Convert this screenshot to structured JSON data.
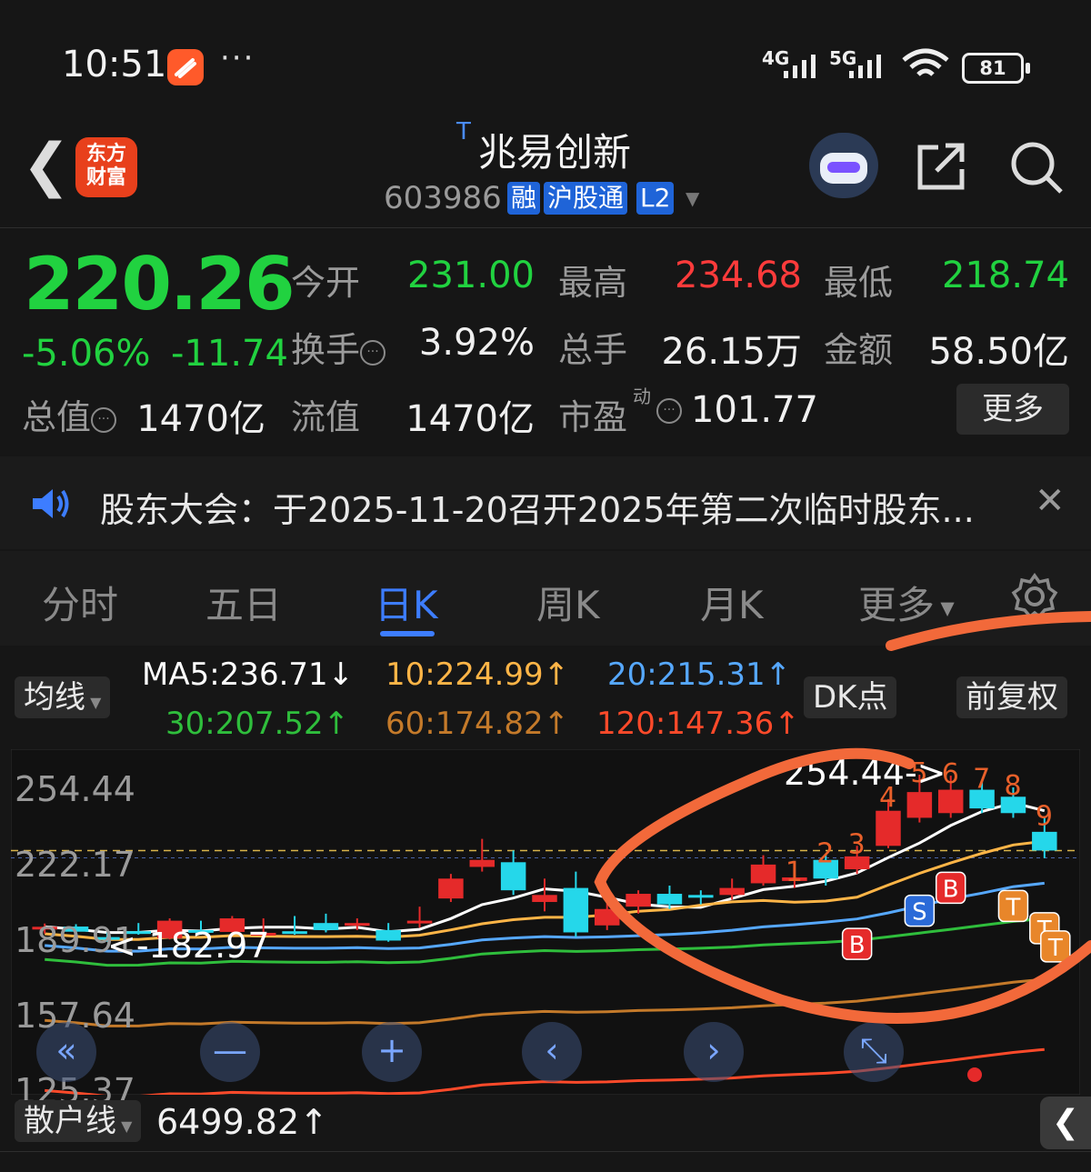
{
  "status_bar": {
    "time": "10:51",
    "more": "···",
    "net1": "4G",
    "net2": "5G",
    "battery": "81",
    "icons": [
      "signal-icon",
      "wifi-icon",
      "battery-icon"
    ]
  },
  "header": {
    "app_logo": "东方\n财富",
    "badge": "T",
    "stock_name": "兆易创新",
    "stock_code": "603986",
    "tags": [
      "融",
      "沪股通",
      "L2"
    ]
  },
  "quote": {
    "price": "220.26",
    "change_pct": "-5.06%",
    "change_abs": "-11.74",
    "open_label": "今开",
    "open": "231.00",
    "high_label": "最高",
    "high": "234.68",
    "low_label": "最低",
    "low": "218.74",
    "turnover_label": "换手",
    "turnover": "3.92%",
    "volume_label": "总手",
    "volume": "26.15万",
    "amount_label": "金额",
    "amount": "58.50亿",
    "mktcap_label": "总值",
    "mktcap": "1470亿",
    "float_label": "流值",
    "float": "1470亿",
    "pe_label": "市盈",
    "pe_sup": "动",
    "pe": "101.77",
    "more_button": "更多",
    "colors": {
      "down": "#21d240",
      "up": "#ff3b3b"
    }
  },
  "notice": {
    "text": "股东大会：于2025-11-20召开2025年第二次临时股东..."
  },
  "tabs": [
    "分时",
    "五日",
    "日K",
    "周K",
    "月K",
    "更多"
  ],
  "active_tab": "日K",
  "ma_row": {
    "selector": "均线",
    "ma5": "MA5:236.71↓",
    "ma10": "10:224.99↑",
    "ma20": "20:215.31↑",
    "ma30": "30:207.52↑",
    "ma60": "60:174.82↑",
    "ma120": "120:147.36↑",
    "dk": "DK点",
    "adjust": "前复权",
    "colors": {
      "ma5": "#ffffff",
      "ma10": "#ffb547",
      "ma20": "#56a8ff",
      "ma30": "#2fbe3c",
      "ma60": "#c47a2a",
      "ma120": "#ff4a2a"
    }
  },
  "chart_data": {
    "type": "candlestick",
    "y_ticks": [
      "254.44",
      "222.17",
      "189.91",
      "157.64",
      "125.37"
    ],
    "ylim": [
      125.37,
      254.44
    ],
    "annotations": {
      "high": "254.44->",
      "low": "<-182.97"
    },
    "markers_red_numbers": [
      "1",
      "2",
      "3",
      "4",
      "5",
      "6",
      "7",
      "8",
      "9"
    ],
    "signals": [
      "B",
      "S",
      "B",
      "T",
      "T",
      "T"
    ],
    "candles": [
      {
        "o": 188.5,
        "c": 189.4,
        "h": 190.8,
        "l": 186.5
      },
      {
        "o": 189.5,
        "c": 187.3,
        "h": 190.5,
        "l": 185.5
      },
      {
        "o": 185.0,
        "c": 184.2,
        "h": 187.0,
        "l": 182.97
      },
      {
        "o": 187.5,
        "c": 187.0,
        "h": 191.0,
        "l": 186.0
      },
      {
        "o": 184.5,
        "c": 192.0,
        "h": 193.0,
        "l": 184.0
      },
      {
        "o": 188.0,
        "c": 187.4,
        "h": 192.0,
        "l": 186.0
      },
      {
        "o": 187.2,
        "c": 193.0,
        "h": 194.0,
        "l": 187.0
      },
      {
        "o": 186.0,
        "c": 186.8,
        "h": 193.0,
        "l": 185.0
      },
      {
        "o": 187.5,
        "c": 187.0,
        "h": 194.0,
        "l": 186.0
      },
      {
        "o": 191.0,
        "c": 188.0,
        "h": 195.0,
        "l": 187.0
      },
      {
        "o": 190.0,
        "c": 191.0,
        "h": 193.0,
        "l": 188.0
      },
      {
        "o": 188.0,
        "c": 183.5,
        "h": 191.0,
        "l": 183.0
      },
      {
        "o": 191.0,
        "c": 192.0,
        "h": 198.0,
        "l": 189.0
      },
      {
        "o": 201.5,
        "c": 210.0,
        "h": 212.0,
        "l": 200.0
      },
      {
        "o": 215.0,
        "c": 218.0,
        "h": 227.0,
        "l": 213.0
      },
      {
        "o": 217.0,
        "c": 205.0,
        "h": 222.0,
        "l": 203.0
      },
      {
        "o": 200.0,
        "c": 203.0,
        "h": 210.0,
        "l": 196.0
      },
      {
        "o": 206.0,
        "c": 187.0,
        "h": 213.0,
        "l": 185.0
      },
      {
        "o": 190.0,
        "c": 197.0,
        "h": 207.0,
        "l": 188.0
      },
      {
        "o": 198.0,
        "c": 203.5,
        "h": 205.0,
        "l": 195.0
      },
      {
        "o": 203.5,
        "c": 199.0,
        "h": 207.0,
        "l": 197.0
      },
      {
        "o": 203.0,
        "c": 202.0,
        "h": 205.0,
        "l": 199.0
      },
      {
        "o": 203.0,
        "c": 206.0,
        "h": 210.0,
        "l": 201.0
      },
      {
        "o": 208.0,
        "c": 216.0,
        "h": 220.0,
        "l": 207.0
      },
      {
        "o": 209.0,
        "c": 210.5,
        "h": 212.0,
        "l": 206.0
      },
      {
        "o": 218.0,
        "c": 210.0,
        "h": 220.0,
        "l": 207.0
      },
      {
        "o": 214.0,
        "c": 219.5,
        "h": 224.0,
        "l": 212.0
      },
      {
        "o": 224.0,
        "c": 239.0,
        "h": 244.0,
        "l": 223.0
      },
      {
        "o": 236.0,
        "c": 247.0,
        "h": 254.44,
        "l": 234.0
      },
      {
        "o": 238.0,
        "c": 248.0,
        "h": 254.0,
        "l": 236.0
      },
      {
        "o": 248.0,
        "c": 240.0,
        "h": 252.0,
        "l": 238.0
      },
      {
        "o": 245.0,
        "c": 238.0,
        "h": 249.0,
        "l": 236.0
      },
      {
        "o": 230.0,
        "c": 222.0,
        "h": 236.0,
        "l": 218.74
      }
    ]
  },
  "controls": [
    "double-left-icon",
    "minus-icon",
    "plus-icon",
    "prev-icon",
    "next-icon",
    "shrink-icon"
  ],
  "indicator": {
    "selector": "散户线",
    "value": "6499.82↑"
  }
}
